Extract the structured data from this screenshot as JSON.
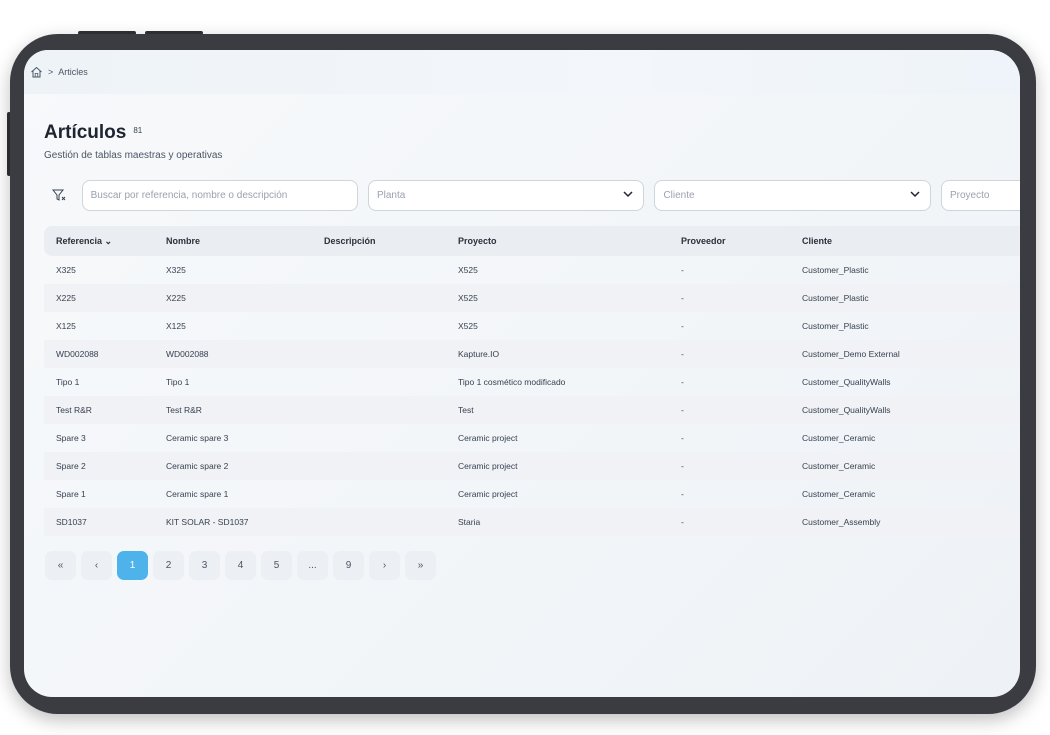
{
  "breadcrumb": {
    "separator": ">",
    "current": "Articles"
  },
  "page": {
    "title": "Artículos",
    "count": "81",
    "subtitle": "Gestión de tablas maestras y operativas"
  },
  "filters": {
    "search_placeholder": "Buscar por referencia, nombre o descripción",
    "planta": "Planta",
    "cliente": "Cliente",
    "proyecto": "Proyecto"
  },
  "table": {
    "columns": [
      "Referencia ⌄",
      "Nombre",
      "Descripción",
      "Proyecto",
      "Proveedor",
      "Cliente"
    ],
    "rows": [
      [
        "X325",
        "X325",
        "",
        "X525",
        "-",
        "Customer_Plastic"
      ],
      [
        "X225",
        "X225",
        "",
        "X525",
        "-",
        "Customer_Plastic"
      ],
      [
        "X125",
        "X125",
        "",
        "X525",
        "-",
        "Customer_Plastic"
      ],
      [
        "WD002088",
        "WD002088",
        "",
        "Kapture.IO",
        "-",
        "Customer_Demo External"
      ],
      [
        "Tipo 1",
        "Tipo 1",
        "",
        "Tipo 1 cosmético modificado",
        "-",
        "Customer_QualityWalls"
      ],
      [
        "Test R&R",
        "Test R&R",
        "",
        "Test",
        "-",
        "Customer_QualityWalls"
      ],
      [
        "Spare 3",
        "Ceramic spare 3",
        "",
        "Ceramic project",
        "-",
        "Customer_Ceramic"
      ],
      [
        "Spare 2",
        "Ceramic spare 2",
        "",
        "Ceramic project",
        "-",
        "Customer_Ceramic"
      ],
      [
        "Spare 1",
        "Ceramic spare 1",
        "",
        "Ceramic project",
        "-",
        "Customer_Ceramic"
      ],
      [
        "SD1037",
        "KIT SOLAR - SD1037",
        "",
        "Staria",
        "-",
        "Customer_Assembly"
      ]
    ]
  },
  "pagination": {
    "first": "«",
    "prev": "‹",
    "pages": [
      "1",
      "2",
      "3",
      "4",
      "5",
      "...",
      "9"
    ],
    "next": "›",
    "last": "»",
    "active": "1"
  },
  "colors": {
    "accent": "#4db3ea",
    "frame": "#3a3c42"
  }
}
